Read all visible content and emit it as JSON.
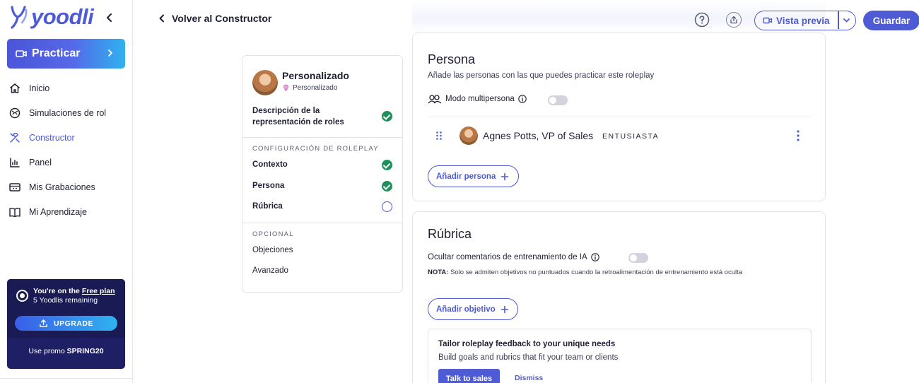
{
  "brand": {
    "name": "yoodli",
    "accent": "#4f5bd5"
  },
  "sidebar": {
    "practicar_label": "Practicar",
    "items": [
      {
        "label": "Inicio",
        "icon": "home-icon"
      },
      {
        "label": "Simulaciones de rol",
        "icon": "roleplay-icon"
      },
      {
        "label": "Constructor",
        "icon": "tools-icon",
        "active": true
      },
      {
        "label": "Panel",
        "icon": "chart-icon"
      },
      {
        "label": "Mis Grabaciones",
        "icon": "recordings-icon"
      },
      {
        "label": "Mi Aprendizaje",
        "icon": "book-icon"
      }
    ],
    "plan": {
      "line1_prefix": "You're on the ",
      "plan_name": "Free plan",
      "line2": "5 Yoodlis remaining",
      "upgrade_label": "UPGRADE",
      "promo_prefix": "Use promo ",
      "promo_code": "SPRING20"
    }
  },
  "topbar": {
    "back_label": "Volver al Constructor",
    "preview_label": "Vista previa",
    "save_label": "Guardar"
  },
  "config": {
    "name": "Personalizado",
    "subtype": "Personalizado",
    "description_label": "Descripción de la representación de roles",
    "section_roleplay": "CONFIGURACIÓN DE ROLEPLAY",
    "steps": [
      {
        "label": "Contexto",
        "done": true
      },
      {
        "label": "Persona",
        "done": true
      },
      {
        "label": "Rúbrica",
        "done": false
      }
    ],
    "section_optional": "OPCIONAL",
    "optional_items": [
      "Objeciones",
      "Avanzado"
    ]
  },
  "persona_card": {
    "title": "Persona",
    "subtitle": "Añade las personas con las que puedes practicar este roleplay",
    "multipersona_label": "Modo multipersona",
    "persona": {
      "name": "Agnes Potts, VP of Sales",
      "tag": "ENTUSIASTA"
    },
    "add_label": "Añadir persona"
  },
  "rubric_card": {
    "title": "Rúbrica",
    "hide_label": "Ocultar comentarios de entrenamiento de IA",
    "note_prefix": "NOTA:",
    "note_text": " Solo se admiten objetivos no puntuados cuando la retroalimentación de entrenamiento está oculta",
    "add_label": "Añadir objetivo",
    "promo": {
      "title": "Tailor roleplay feedback to your unique needs",
      "subtitle": "Build goals and rubrics that fit your team or clients",
      "cta_label": "Talk to sales",
      "dismiss_label": "Dismiss"
    }
  }
}
